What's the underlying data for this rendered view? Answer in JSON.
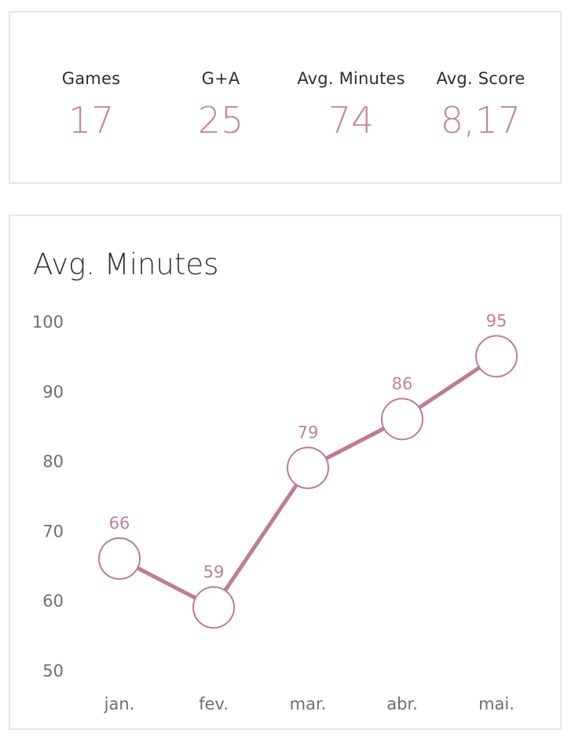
{
  "kpis": [
    {
      "label": "Games",
      "value": "17"
    },
    {
      "label": "G+A",
      "value": "25"
    },
    {
      "label": "Avg. Minutes",
      "value": "74"
    },
    {
      "label": "Avg. Score",
      "value": "8,17"
    }
  ],
  "colors": {
    "accent": "#c4869f",
    "line": "#c27a96",
    "text": "#2f2f2f",
    "tick": "#6f6f6f",
    "border": "#e6e6e6"
  },
  "chart_data": {
    "type": "line",
    "title": "Avg. Minutes",
    "xlabel": "",
    "ylabel": "",
    "categories": [
      "jan.",
      "fev.",
      "mar.",
      "abr.",
      "mai."
    ],
    "values": [
      66,
      59,
      79,
      86,
      95
    ],
    "yticks": [
      50,
      60,
      70,
      80,
      90,
      100
    ],
    "ylim": [
      50,
      100
    ],
    "grid": false,
    "legend": "none"
  }
}
